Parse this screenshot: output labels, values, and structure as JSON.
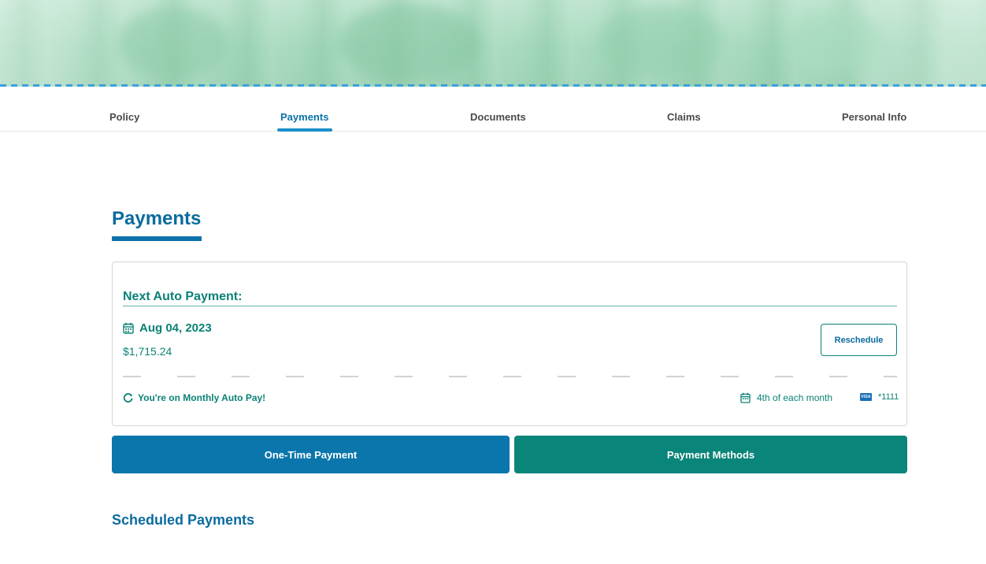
{
  "tabs": [
    {
      "label": "Policy"
    },
    {
      "label": "Payments"
    },
    {
      "label": "Documents"
    },
    {
      "label": "Claims"
    },
    {
      "label": "Personal Info"
    }
  ],
  "active_tab": "Payments",
  "page": {
    "title": "Payments"
  },
  "auto_payment": {
    "heading": "Next Auto Payment:",
    "date": "Aug 04, 2023",
    "amount": "$1,715.24",
    "reschedule_label": "Reschedule",
    "status": "You're on Monthly Auto Pay!",
    "schedule": "4th of each month",
    "card_brand": "VISA",
    "card_last4": "*1111"
  },
  "actions": {
    "one_time_label": "One-Time Payment",
    "methods_label": "Payment Methods"
  },
  "scheduled": {
    "title": "Scheduled Payments"
  },
  "icons": {
    "date": "calendar-icon",
    "autopay": "refresh-icon",
    "schedule": "calendar-icon",
    "card": "visa-card-icon"
  },
  "colors": {
    "primary_blue": "#0b76ac",
    "teal": "#0a8579",
    "tab_active": "#0b72aa"
  }
}
